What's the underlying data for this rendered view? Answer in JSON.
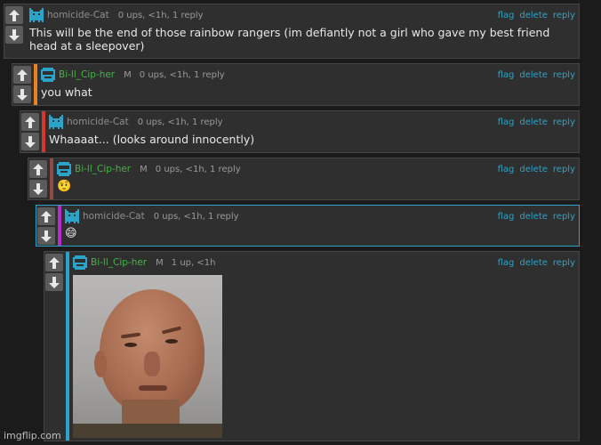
{
  "colors": {
    "link": "#2aa4c8",
    "cat_name": "#8f8f8f",
    "bill_name": "#45b545",
    "cat_icon": "#2aa4c8",
    "bill_icon": "#2aa4c8"
  },
  "actions": {
    "flag": "flag",
    "delete": "delete",
    "reply": "reply"
  },
  "comments": [
    {
      "user": "homicide-Cat",
      "mod": "",
      "meta": "0 ups, <1h, 1 reply",
      "text": "This will be the end of those rainbow rangers (im defiantly not a girl who gave my best friend head at a sleepover)",
      "bar_color": ""
    },
    {
      "user": "Bi-ll_Cip-her",
      "mod": "M",
      "meta": "0 ups, <1h, 1 reply",
      "text": "you what",
      "bar_color": "#e8821e"
    },
    {
      "user": "homicide-Cat",
      "mod": "",
      "meta": "0 ups, <1h, 1 reply",
      "text": "Whaaaat... (looks around innocently)",
      "bar_color": "#d8372e"
    },
    {
      "user": "Bi-ll_Cip-her",
      "mod": "M",
      "meta": "0 ups, <1h, 1 reply",
      "text": "🤨",
      "bar_color": "#8e4b46"
    },
    {
      "user": "homicide-Cat",
      "mod": "",
      "meta": "0 ups, <1h, 1 reply",
      "text": "😄",
      "bar_color": "#b52cc8"
    },
    {
      "user": "Bi-ll_Cip-her",
      "mod": "M",
      "meta": "1 up, <1h",
      "text": "",
      "image": "the-rock-eyebrow-meme",
      "bar_color": "#2aa4c8"
    }
  ],
  "watermark": "imgflip.com"
}
